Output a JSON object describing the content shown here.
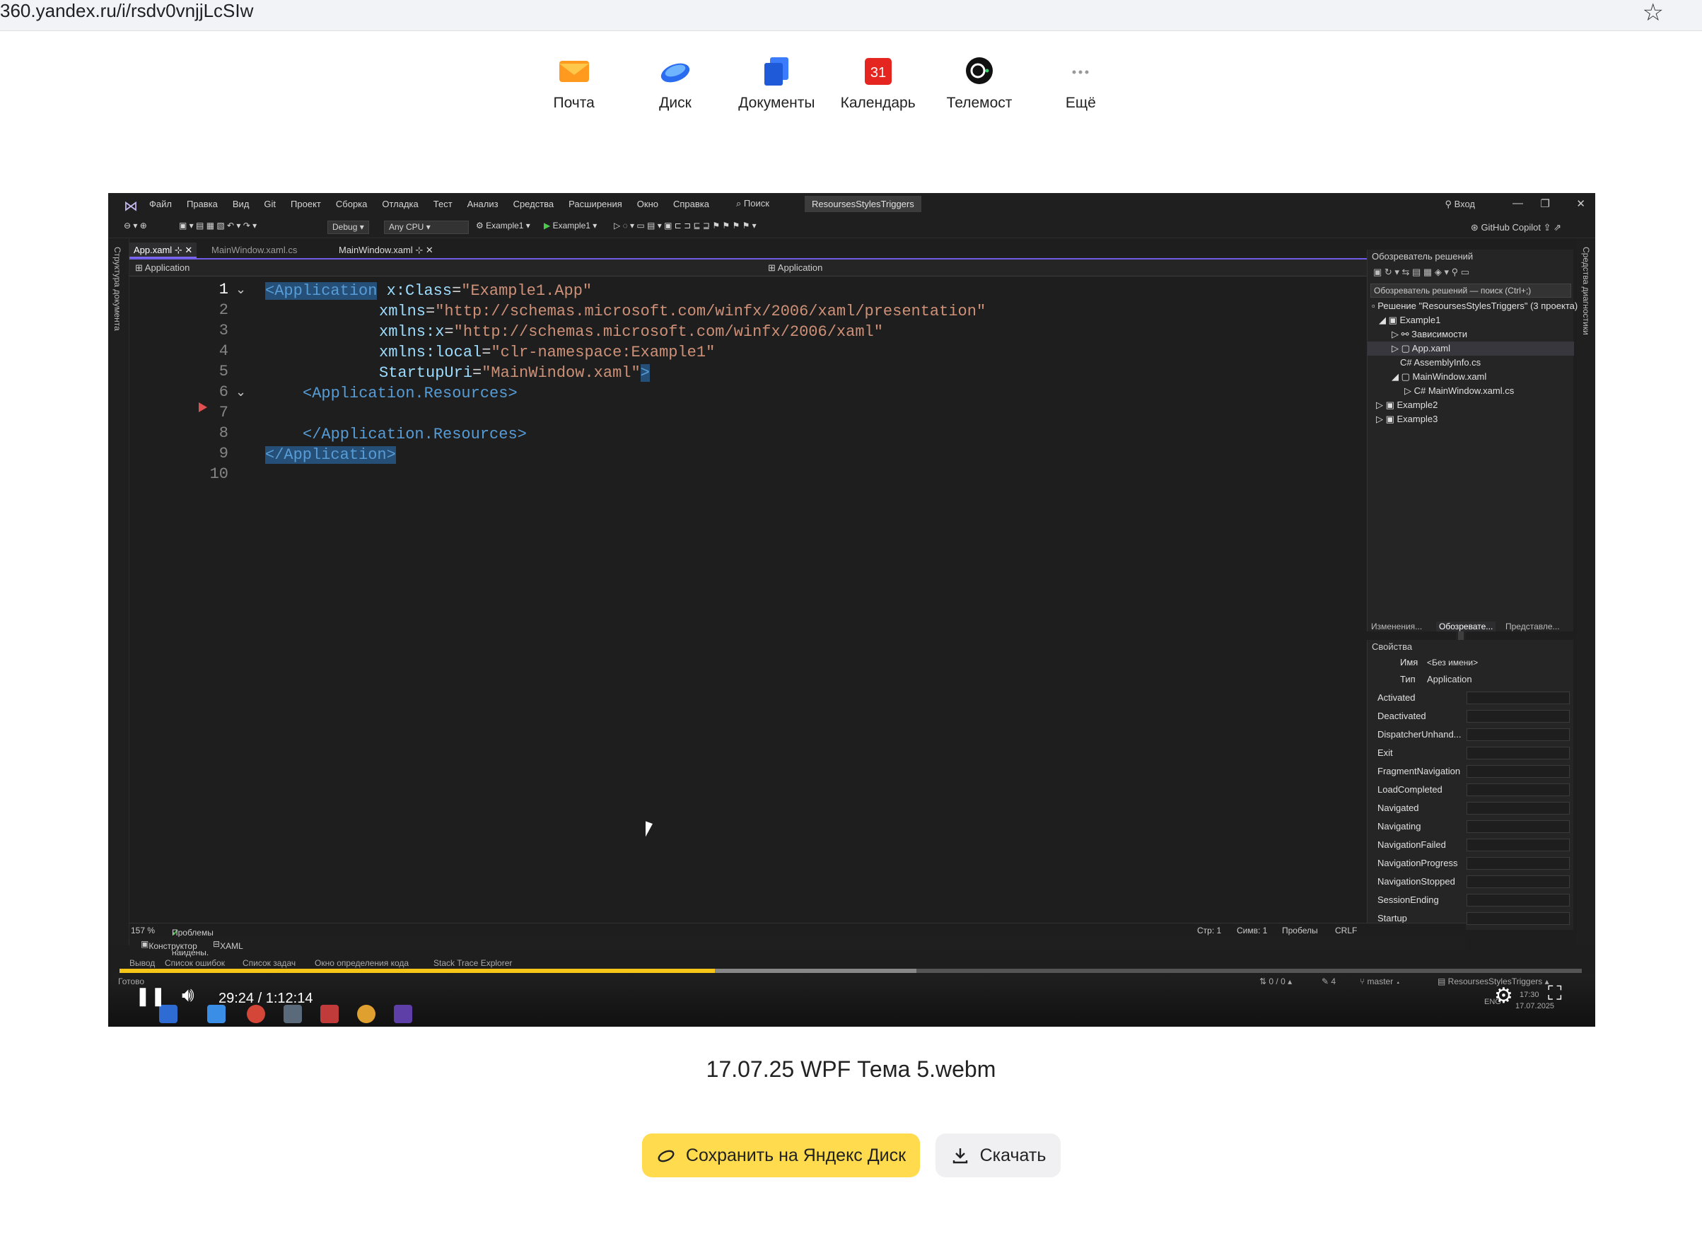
{
  "address_bar": {
    "url": "360.yandex.ru/i/rsdv0vnjjLcSIw"
  },
  "services": [
    {
      "label": "Почта",
      "icon": "mail-icon"
    },
    {
      "label": "Диск",
      "icon": "disk-icon"
    },
    {
      "label": "Документы",
      "icon": "documents-icon"
    },
    {
      "label": "Календарь",
      "icon": "calendar-icon",
      "badge": "31"
    },
    {
      "label": "Телемост",
      "icon": "telemost-icon"
    },
    {
      "label": "Ещё",
      "icon": "more-icon"
    }
  ],
  "ide": {
    "menu": [
      "Файл",
      "Правка",
      "Вид",
      "Git",
      "Проект",
      "Сборка",
      "Отладка",
      "Тест",
      "Анализ",
      "Средства",
      "Расширения",
      "Окно",
      "Справка"
    ],
    "search": "Поиск",
    "project_name": "ResoursesStylesTriggers",
    "login": "Вход",
    "toolbar": {
      "config": "Debug",
      "platform": "Any CPU",
      "startup": "Example1",
      "run": "Example1",
      "copilot": "GitHub Copilot"
    },
    "left_strip": "Структура документа",
    "right_strip": "Средства диагностики",
    "tabs": [
      "App.xaml",
      "MainWindow.xaml.cs",
      "MainWindow.xaml"
    ],
    "nav_left": "Application",
    "nav_right": "Application",
    "line_numbers": [
      "1",
      "2",
      "3",
      "4",
      "5",
      "6",
      "7",
      "8",
      "9",
      "10"
    ],
    "code": {
      "l1_tag": "<Application",
      "l1_attr": " x:Class",
      "l1_eq": "=",
      "l1_val": "\"Example1.App\"",
      "l2_attr": "xmlns",
      "l2_val": "\"http://schemas.microsoft.com/winfx/2006/xaml/presentation\"",
      "l3_attr": "xmlns:x",
      "l3_val": "\"http://schemas.microsoft.com/winfx/2006/xaml\"",
      "l4_attr": "xmlns:local",
      "l4_val": "\"clr-namespace:Example1\"",
      "l5_attr": "StartupUri",
      "l5_val": "\"MainWindow.xaml\"",
      "l5_close": ">",
      "l6": "<Application.Resources>",
      "l8": "</Application.Resources>",
      "l9": "</Application>"
    },
    "status": {
      "zoom": "157 %",
      "problems": "Проблемы не найдены.",
      "line": "Стр: 1",
      "col": "Симв: 1",
      "spaces": "Пробелы",
      "eol": "CRLF"
    },
    "status2": {
      "designer": "Конструктор",
      "xaml": "XAML"
    },
    "output_tabs": [
      "Вывод",
      "Список ошибок",
      "Список задач",
      "Окно определения кода",
      "Stack Trace Explorer"
    ],
    "solution": {
      "header": "Обозреватель решений",
      "search": "Обозреватель решений — поиск (Ctrl+;)",
      "items": [
        "Решение \"ResoursesStylesTriggers\" (3 проекта)",
        "Example1",
        "Зависимости",
        "App.xaml",
        "AssemblyInfo.cs",
        "MainWindow.xaml",
        "MainWindow.xaml.cs",
        "Example2",
        "Example3"
      ],
      "tabs": [
        "Изменения...",
        "Обозревате...",
        "Представле..."
      ]
    },
    "properties": {
      "header": "Свойства",
      "name_label": "Имя",
      "name_value": "<Без имени>",
      "type_label": "Тип",
      "type_value": "Application",
      "events": [
        "Activated",
        "Deactivated",
        "DispatcherUnhand...",
        "Exit",
        "FragmentNavigation",
        "LoadCompleted",
        "Navigated",
        "Navigating",
        "NavigationFailed",
        "NavigationProgress",
        "NavigationStopped",
        "SessionEnding",
        "Startup"
      ]
    },
    "taskbar": {
      "ready": "Готово",
      "git": "0 / 0",
      "pencil": "4",
      "branch": "master",
      "repo": "ResoursesStylesTriggers",
      "lang": "ENG",
      "clock_time": "17:30",
      "clock_date": "17.07.2025"
    }
  },
  "player": {
    "time": "29:24 / 1:12:14",
    "progress": 0.407,
    "buffered": 0.545
  },
  "file_title": "17.07.25 WPF Тема 5.webm",
  "buttons": {
    "save": "Сохранить на Яндекс Диск",
    "download": "Скачать"
  },
  "colors": {
    "save_button": "#ffdb4d",
    "progress": "#f5c518",
    "calendar": "#e52620"
  }
}
